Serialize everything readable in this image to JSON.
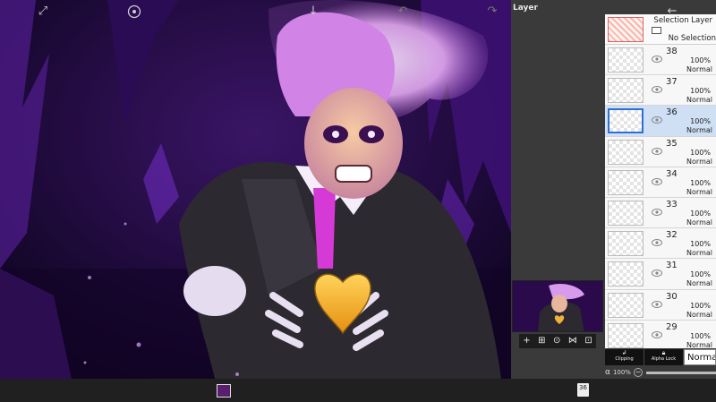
{
  "panel": {
    "title": "Layer"
  },
  "selection_layer": {
    "title": "Selection Layer",
    "value": "No Selection"
  },
  "layers": [
    {
      "number": "38",
      "opacity": "100%",
      "mode": "Normal",
      "selected": false
    },
    {
      "number": "37",
      "opacity": "100%",
      "mode": "Normal",
      "selected": false
    },
    {
      "number": "36",
      "opacity": "100%",
      "mode": "Normal",
      "selected": true
    },
    {
      "number": "35",
      "opacity": "100%",
      "mode": "Normal",
      "selected": false
    },
    {
      "number": "34",
      "opacity": "100%",
      "mode": "Normal",
      "selected": false
    },
    {
      "number": "33",
      "opacity": "100%",
      "mode": "Normal",
      "selected": false
    },
    {
      "number": "32",
      "opacity": "100%",
      "mode": "Normal",
      "selected": false
    },
    {
      "number": "31",
      "opacity": "100%",
      "mode": "Normal",
      "selected": false
    },
    {
      "number": "30",
      "opacity": "100%",
      "mode": "Normal",
      "selected": false
    },
    {
      "number": "29",
      "opacity": "100%",
      "mode": "Normal",
      "selected": false
    }
  ],
  "blend": {
    "clipping_label": "Clipping",
    "alpha_lock_label": "Alpha Lock",
    "mode_value": "Normal"
  },
  "alpha": {
    "symbol": "α",
    "value": "100%",
    "minus": "−",
    "level": 1.0
  },
  "preview_tools": [
    "+",
    "⊞",
    "⊙",
    "⋈",
    "⊡"
  ],
  "toolbar": {
    "icons": [
      "transform-icon",
      "brush-size-icon",
      "color-swatch",
      "download-icon",
      "undo-icon",
      "redo-icon",
      "layers-icon",
      "back-icon"
    ],
    "layer_count": "36",
    "current_color": "#5a1e6e"
  },
  "colors": {
    "accent": "#2f6fd4",
    "glow": "#c98bdc",
    "background": "#1a0830"
  }
}
